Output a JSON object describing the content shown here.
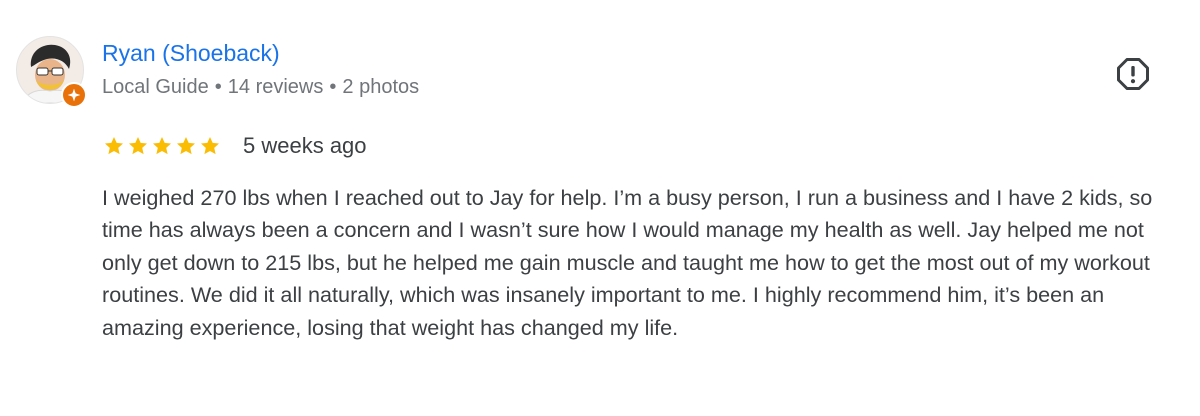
{
  "reviewer": {
    "name": "Ryan (Shoeback)",
    "badge": "Local Guide",
    "separator": "•",
    "reviews_count": "14 reviews",
    "photos_count": "2 photos",
    "avatar_icon": "avatar-illustration",
    "badge_icon": "local-guide-star-icon",
    "badge_color": "#e8710a"
  },
  "rating": {
    "stars": 5,
    "max": 5,
    "star_color": "#fbbc04",
    "date": "5 weeks ago"
  },
  "review": {
    "text": "I weighed 270 lbs when I reached out to Jay for help. I’m a busy person, I run a business and I have 2 kids, so time has always been a concern and I wasn’t sure how I would manage my health as well. Jay helped me not only get down to 215 lbs, but he helped me gain muscle and taught me how to get the most out of my workout routines. We did it all naturally, which was insanely important to me. I highly recommend him, it’s been an amazing experience, losing that weight has changed my life."
  },
  "actions": {
    "report_icon": "report-icon"
  },
  "colors": {
    "name_link": "#1a73e8",
    "meta_text": "#70757a",
    "body_text": "#3c4043"
  }
}
